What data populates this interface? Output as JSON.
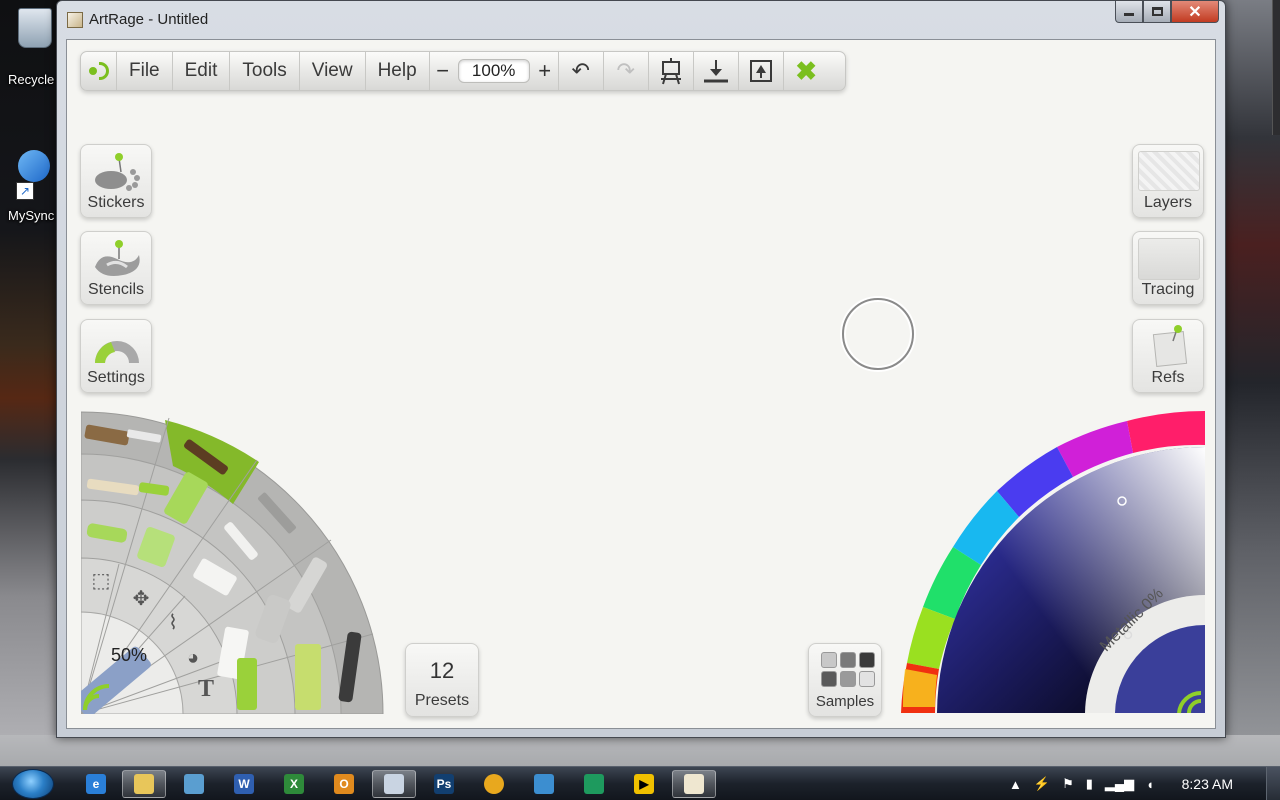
{
  "window": {
    "title": "ArtRage - Untitled"
  },
  "desktop": {
    "icons": [
      {
        "label": "Recycle"
      },
      {
        "label": "MySync"
      }
    ]
  },
  "toolbar": {
    "menus": [
      "File",
      "Edit",
      "Tools",
      "View",
      "Help"
    ],
    "zoom_out": "−",
    "zoom_value": "100%",
    "zoom_in": "+"
  },
  "left_panel": {
    "stickers": "Stickers",
    "stencils": "Stencils",
    "settings": "Settings"
  },
  "right_panel": {
    "layers": "Layers",
    "tracing": "Tracing",
    "refs": "Refs"
  },
  "tool_wheel": {
    "size_percent": "50%",
    "text_tool": "T"
  },
  "presets": {
    "count": "12",
    "label": "Presets"
  },
  "samples": {
    "label": "Samples",
    "swatches": [
      "#c8c8c8",
      "#7a7a7a",
      "#3a3a3a",
      "#5a5a5a",
      "#9a9a9a",
      "#e2e2e2"
    ]
  },
  "color_picker": {
    "metallic": "Metallic 0%",
    "current_color": "#3a3f9a"
  },
  "taskbar": {
    "clock": "8:23 AM"
  },
  "colors": {
    "accent_green": "#7bbf1f",
    "canvas": "#f5f5f2",
    "toolbar_bg": "#ebebe9"
  }
}
